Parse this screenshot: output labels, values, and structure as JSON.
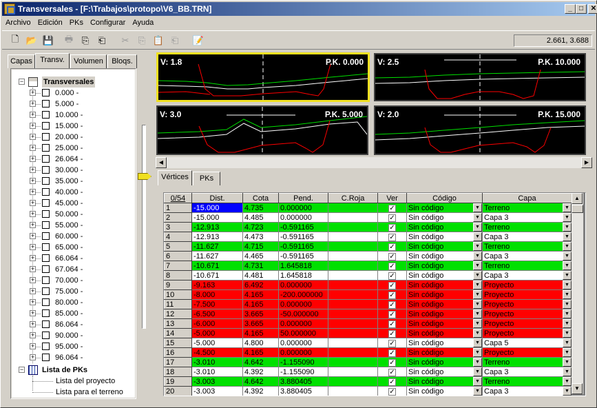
{
  "window": {
    "title": "Transversales - [F:\\Trabajos\\protopo\\V6_BB.TRN]"
  },
  "title_buttons": {
    "minimize": "_",
    "maximize": "□",
    "close": "✕"
  },
  "menu": [
    "Archivo",
    "Edición",
    "PKs",
    "Configurar",
    "Ayuda"
  ],
  "toolbar_icons": [
    "new-file-icon",
    "open-folder-icon",
    "save-icon",
    "print-icon",
    "copy-page-icon",
    "paste-page-icon",
    "cut-icon",
    "copy-icon",
    "paste-icon",
    "paste-special-icon",
    "properties-icon"
  ],
  "toolbar_glyphs": [
    "🗋",
    "📂",
    "💾",
    "🖶",
    "⎘",
    "⎗",
    "✂",
    "⎘",
    "📋",
    "⎗",
    "📝"
  ],
  "coordinates": "2.661, 3.688",
  "left_tabs": [
    "Capas",
    "Transv.",
    "Volumen",
    "Bloqs."
  ],
  "tree": {
    "root": "Transversales",
    "items": [
      "0.000 -",
      "5.000 -",
      "10.000 -",
      "15.000 -",
      "20.000 -",
      "25.000 -",
      "26.064 -",
      "30.000 -",
      "35.000 -",
      "40.000 -",
      "45.000 -",
      "50.000 -",
      "55.000 -",
      "60.000 -",
      "65.000 -",
      "66.064 -",
      "67.064 -",
      "70.000 -",
      "75.000 -",
      "80.000 -",
      "85.000 -",
      "86.064 -",
      "90.000 -",
      "95.000 -",
      "96.064 -"
    ],
    "pk_root": "Lista de PKs",
    "pk_items": [
      "Lista del proyecto",
      "Lista para el terreno"
    ]
  },
  "plots": [
    {
      "v": "V: 1.8",
      "pk": "P.K. 0.000"
    },
    {
      "v": "V: 2.5",
      "pk": "P.K. 10.000"
    },
    {
      "v": "V: 3.0",
      "pk": "P.K. 5.000"
    },
    {
      "v": "V: 2.0",
      "pk": "P.K. 15.000"
    }
  ],
  "bottom_tabs": [
    "Vértices",
    "PKs"
  ],
  "table": {
    "counter": "0/54",
    "headers": [
      "Dist.",
      "Cota",
      "Pend.",
      "C.Roja",
      "Ver",
      "Código",
      "Capa"
    ],
    "rows": [
      {
        "n": "1",
        "dist": "-15.000",
        "cota": "4.735",
        "pend": "0.000000",
        "codigo": "Sin código",
        "capa": "Terreno",
        "color": "green"
      },
      {
        "n": "2",
        "dist": "-15.000",
        "cota": "4.485",
        "pend": "0.000000",
        "codigo": "Sin código",
        "capa": "Capa 3",
        "color": "white"
      },
      {
        "n": "3",
        "dist": "-12.913",
        "cota": "4.723",
        "pend": "-0.591165",
        "codigo": "Sin código",
        "capa": "Terreno",
        "color": "green"
      },
      {
        "n": "4",
        "dist": "-12.913",
        "cota": "4.473",
        "pend": "-0.591165",
        "codigo": "Sin código",
        "capa": "Capa 3",
        "color": "white"
      },
      {
        "n": "5",
        "dist": "-11.627",
        "cota": "4.715",
        "pend": "-0.591165",
        "codigo": "Sin código",
        "capa": "Terreno",
        "color": "green"
      },
      {
        "n": "6",
        "dist": "-11.627",
        "cota": "4.465",
        "pend": "-0.591165",
        "codigo": "Sin código",
        "capa": "Capa 3",
        "color": "white"
      },
      {
        "n": "7",
        "dist": "-10.671",
        "cota": "4.731",
        "pend": "1.645818",
        "codigo": "Sin código",
        "capa": "Terreno",
        "color": "green"
      },
      {
        "n": "8",
        "dist": "-10.671",
        "cota": "4.481",
        "pend": "1.645818",
        "codigo": "Sin código",
        "capa": "Capa 3",
        "color": "white"
      },
      {
        "n": "9",
        "dist": "-9.163",
        "cota": "6.492",
        "pend": "0.000000",
        "codigo": "Sin código",
        "capa": "Proyecto",
        "color": "red"
      },
      {
        "n": "10",
        "dist": "-8.000",
        "cota": "4.165",
        "pend": "-200.000000",
        "codigo": "Sin código",
        "capa": "Proyecto",
        "color": "red"
      },
      {
        "n": "11",
        "dist": "-7.500",
        "cota": "4.165",
        "pend": "0.000000",
        "codigo": "Sin código",
        "capa": "Proyecto",
        "color": "red"
      },
      {
        "n": "12",
        "dist": "-6.500",
        "cota": "3.665",
        "pend": "-50.000000",
        "codigo": "Sin código",
        "capa": "Proyecto",
        "color": "red"
      },
      {
        "n": "13",
        "dist": "-6.000",
        "cota": "3.665",
        "pend": "0.000000",
        "codigo": "Sin código",
        "capa": "Proyecto",
        "color": "red"
      },
      {
        "n": "14",
        "dist": "-5.000",
        "cota": "4.165",
        "pend": "50.000000",
        "codigo": "Sin código",
        "capa": "Proyecto",
        "color": "red"
      },
      {
        "n": "15",
        "dist": "-5.000",
        "cota": "4.800",
        "pend": "0.000000",
        "codigo": "Sin código",
        "capa": "Capa 5",
        "color": "white"
      },
      {
        "n": "16",
        "dist": "-4.500",
        "cota": "4.165",
        "pend": "0.000000",
        "codigo": "Sin código",
        "capa": "Proyecto",
        "color": "red"
      },
      {
        "n": "17",
        "dist": "-3.010",
        "cota": "4.642",
        "pend": "-1.155090",
        "codigo": "Sin código",
        "capa": "Terreno",
        "color": "green"
      },
      {
        "n": "18",
        "dist": "-3.010",
        "cota": "4.392",
        "pend": "-1.155090",
        "codigo": "Sin código",
        "capa": "Capa 3",
        "color": "white"
      },
      {
        "n": "19",
        "dist": "-3.003",
        "cota": "4.642",
        "pend": "3.880405",
        "codigo": "Sin código",
        "capa": "Terreno",
        "color": "green"
      },
      {
        "n": "20",
        "dist": "-3.003",
        "cota": "4.392",
        "pend": "3.880405",
        "codigo": "Sin código",
        "capa": "Capa 3",
        "color": "white"
      }
    ]
  },
  "colors": {
    "green": "#00e000",
    "red": "#ff0000",
    "white": "#ffffff",
    "selection": "#0000ff",
    "plot_highlight": "#f0e020"
  }
}
